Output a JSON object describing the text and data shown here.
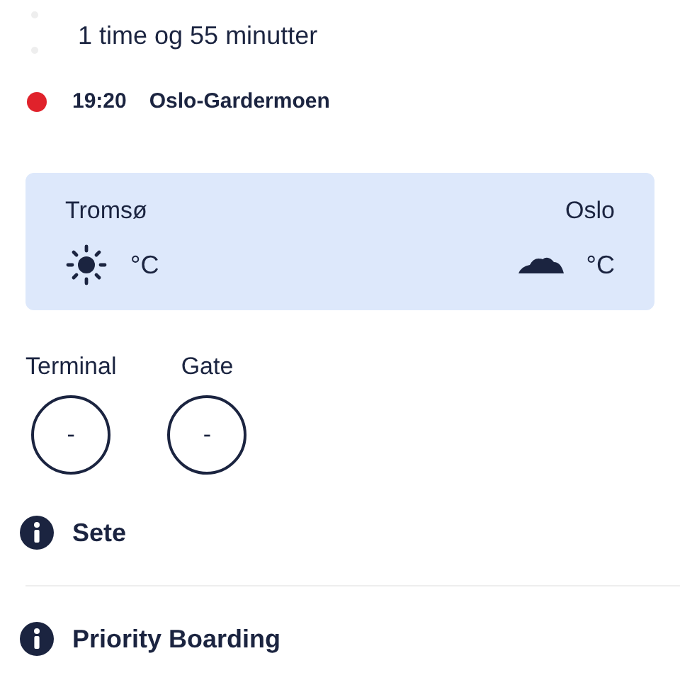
{
  "duration": "1 time og 55 minutter",
  "arrival": {
    "time": "19:20",
    "airport": "Oslo-Gardermoen",
    "color": "#e0222b"
  },
  "weather": [
    {
      "city": "Tromsø",
      "kind": "sun",
      "temperature": "°C"
    },
    {
      "city": "Oslo",
      "kind": "cloud",
      "temperature": "°C"
    }
  ],
  "gate_info": [
    {
      "label": "Terminal",
      "value": "-"
    },
    {
      "label": "Gate",
      "value": "-"
    }
  ],
  "info_rows": [
    {
      "label": "Sete"
    },
    {
      "label": "Priority Boarding"
    }
  ]
}
